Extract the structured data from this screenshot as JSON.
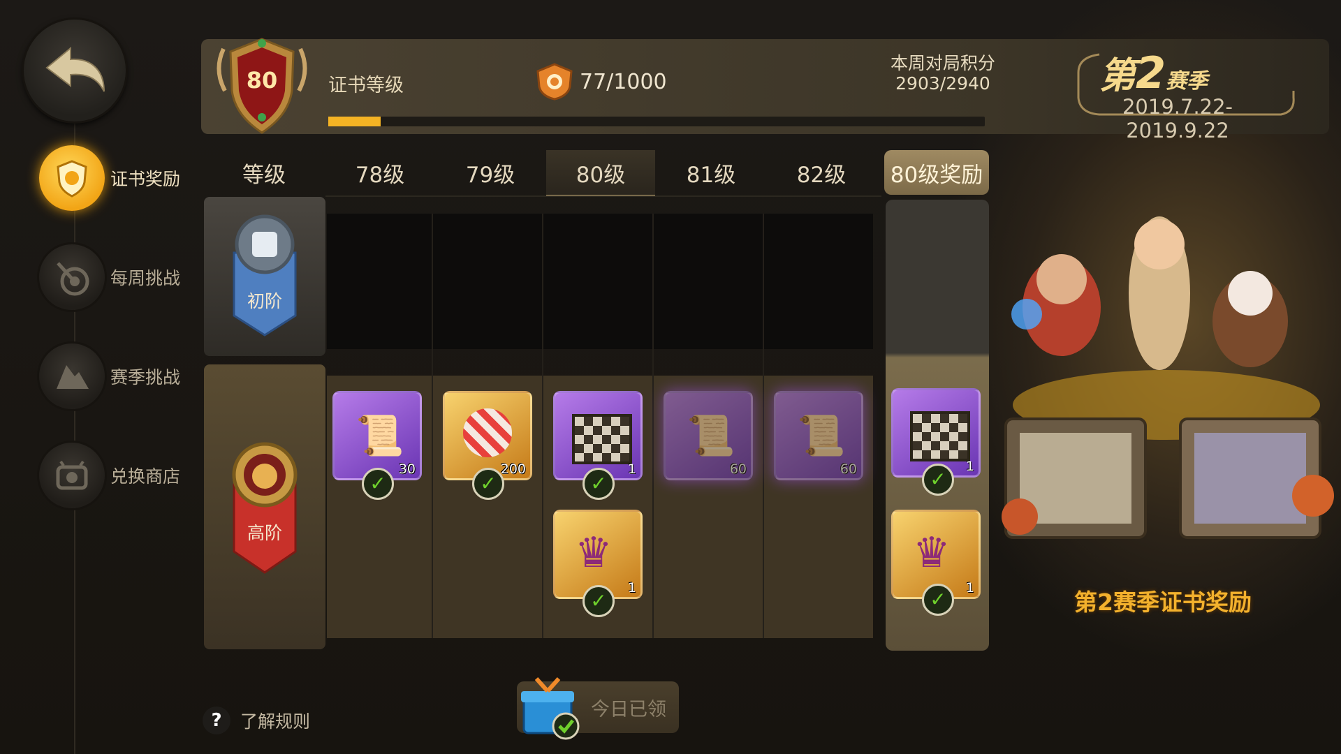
{
  "header": {
    "level": "80",
    "cert_label": "证书等级",
    "xp_progress": 0.08,
    "coins": "77/1000",
    "week_label": "本周对局积分",
    "week_value": "2903/2940",
    "season_prefix": "第",
    "season_num": "2",
    "season_suffix": "赛季",
    "season_dates": "2019.7.22-2019.9.22"
  },
  "sidebar": {
    "items": [
      {
        "label": "证书奖励",
        "icon": "certificate-icon",
        "active": true
      },
      {
        "label": "每周挑战",
        "icon": "target-icon",
        "active": false
      },
      {
        "label": "赛季挑战",
        "icon": "mountain-icon",
        "active": false
      },
      {
        "label": "兑换商店",
        "icon": "shop-icon",
        "active": false
      }
    ]
  },
  "tabs": [
    "等级",
    "78级",
    "79级",
    "80级",
    "81级",
    "82级",
    "80级奖励"
  ],
  "selected_tab": "80级",
  "rows": {
    "basic": "初阶",
    "advanced": "高阶"
  },
  "items": {
    "lvl78_adv": {
      "count": "30",
      "icon": "scroll-icon"
    },
    "lvl79_adv": {
      "count": "200",
      "icon": "candy-icon"
    },
    "lvl80_adv_1": {
      "count": "1",
      "icon": "chessboard-icon"
    },
    "lvl80_adv_2": {
      "count": "1",
      "icon": "crown-icon"
    },
    "lvl81_adv": {
      "count": "60",
      "icon": "scroll-icon"
    },
    "lvl82_adv": {
      "count": "60",
      "icon": "scroll-icon"
    },
    "reward_1": {
      "count": "1",
      "icon": "chessboard-icon"
    },
    "reward_2": {
      "count": "1",
      "icon": "crown-icon"
    }
  },
  "footer": {
    "help": "了解规则",
    "daily": "今日已领"
  },
  "right_title": "第2赛季证书奖励",
  "colors": {
    "accent": "#f4b324",
    "purple": "#8b4fd1",
    "gold": "#e3a63a",
    "check": "#6fd12c"
  }
}
